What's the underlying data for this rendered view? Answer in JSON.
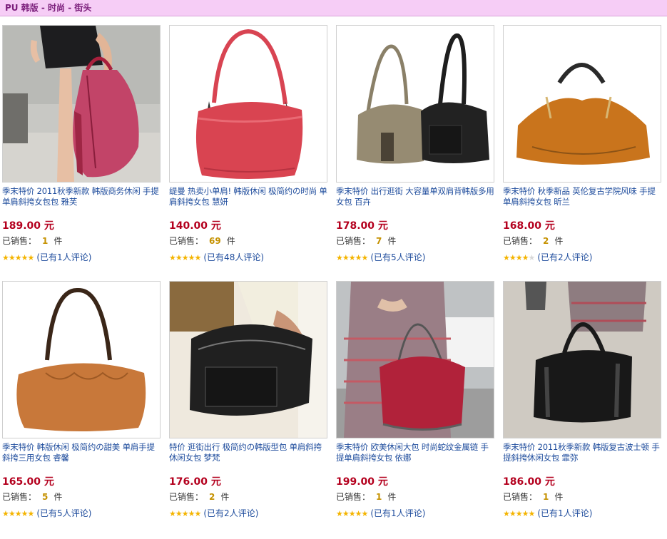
{
  "header": {
    "title": "PU 韩版 - 时尚 - 街头"
  },
  "labels": {
    "currency": "元",
    "sold_prefix": "已销售：",
    "unit": "件"
  },
  "colors": {
    "header_bg": "#f6cdf6",
    "price": "#b4001e",
    "link": "#1d4b9c",
    "star": "#f4b400"
  },
  "products": [
    {
      "title": "季末特价 2011秋季新款 韩版商务休闲 手提单肩斜挎女包包 雅芙",
      "price": "189.00",
      "sold": "1",
      "rating": 5,
      "reviews": "(已有1人评论)"
    },
    {
      "title": "缇曼 热卖小单肩! 韩版休闲 极简约の时尚 单肩斜挎女包 慧妍",
      "price": "140.00",
      "sold": "69",
      "rating": 5,
      "reviews": "(已有48人评论)"
    },
    {
      "title": "季末特价 出行逛街 大容量单双肩背韩版多用女包 百卉",
      "price": "178.00",
      "sold": "7",
      "rating": 5,
      "reviews": "(已有5人评论)"
    },
    {
      "title": "季末特价 秋季新品 英伦复古学院风味 手提单肩斜挎女包 昕兰",
      "price": "168.00",
      "sold": "2",
      "rating": 4,
      "reviews": "(已有2人评论)"
    },
    {
      "title": "季末特价 韩版休闲 极简约の甜美 单肩手提斜挎三用女包 睿馨",
      "price": "165.00",
      "sold": "5",
      "rating": 5,
      "reviews": "(已有5人评论)"
    },
    {
      "title": "特价 逛街出行 极简约の韩版型包 单肩斜挎休闲女包 梦梵",
      "price": "176.00",
      "sold": "2",
      "rating": 5,
      "reviews": "(已有2人评论)"
    },
    {
      "title": "季末特价 欧美休闲大包 时尚蛇纹金属链 手提单肩斜挎女包 依娜",
      "price": "199.00",
      "sold": "1",
      "rating": 5,
      "reviews": "(已有1人评论)"
    },
    {
      "title": "季末特价 2011秋季新款 韩版复古波士顿 手提斜挎休闲女包 霏弥",
      "price": "186.00",
      "sold": "1",
      "rating": 5,
      "reviews": "(已有1人评论)"
    }
  ]
}
